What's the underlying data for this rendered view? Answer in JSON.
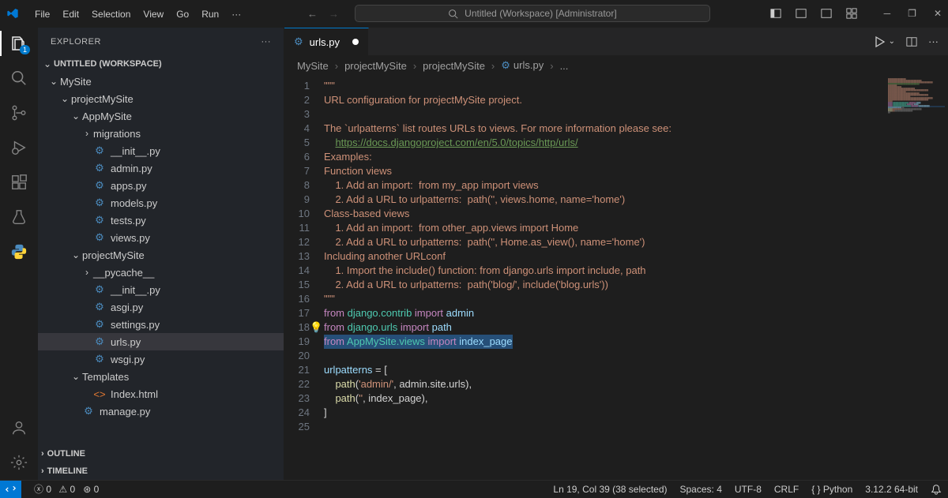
{
  "titlebar": {
    "menus": [
      "File",
      "Edit",
      "Selection",
      "View",
      "Go",
      "Run",
      "···"
    ],
    "command_center": "Untitled (Workspace) [Administrator]"
  },
  "sidebar": {
    "title": "EXPLORER",
    "workspace": "UNTITLED (WORKSPACE)",
    "tree": [
      {
        "label": "MySite",
        "depth": 0,
        "type": "folder",
        "open": true
      },
      {
        "label": "projectMySite",
        "depth": 1,
        "type": "folder",
        "open": true
      },
      {
        "label": "AppMySite",
        "depth": 2,
        "type": "folder",
        "open": true
      },
      {
        "label": "migrations",
        "depth": 3,
        "type": "folder",
        "open": false
      },
      {
        "label": "__init__.py",
        "depth": 3,
        "type": "py"
      },
      {
        "label": "admin.py",
        "depth": 3,
        "type": "py"
      },
      {
        "label": "apps.py",
        "depth": 3,
        "type": "py"
      },
      {
        "label": "models.py",
        "depth": 3,
        "type": "py"
      },
      {
        "label": "tests.py",
        "depth": 3,
        "type": "py"
      },
      {
        "label": "views.py",
        "depth": 3,
        "type": "py"
      },
      {
        "label": "projectMySite",
        "depth": 2,
        "type": "folder",
        "open": true
      },
      {
        "label": "__pycache__",
        "depth": 3,
        "type": "folder",
        "open": false
      },
      {
        "label": "__init__.py",
        "depth": 3,
        "type": "py"
      },
      {
        "label": "asgi.py",
        "depth": 3,
        "type": "py"
      },
      {
        "label": "settings.py",
        "depth": 3,
        "type": "py"
      },
      {
        "label": "urls.py",
        "depth": 3,
        "type": "py",
        "selected": true
      },
      {
        "label": "wsgi.py",
        "depth": 3,
        "type": "py"
      },
      {
        "label": "Templates",
        "depth": 2,
        "type": "folder",
        "open": true
      },
      {
        "label": "Index.html",
        "depth": 3,
        "type": "html"
      },
      {
        "label": "manage.py",
        "depth": 2,
        "type": "py"
      }
    ],
    "outline": "OUTLINE",
    "timeline": "TIMELINE"
  },
  "editor": {
    "tab_label": "urls.py",
    "breadcrumb": [
      "MySite",
      "projectMySite",
      "projectMySite",
      "urls.py",
      "..."
    ],
    "lines": [
      {
        "n": 1,
        "html": "<span class='tok-str'>\"\"\"</span>"
      },
      {
        "n": 2,
        "html": "<span class='tok-str'>URL configuration for projectMySite project.</span>"
      },
      {
        "n": 3,
        "html": ""
      },
      {
        "n": 4,
        "html": "<span class='tok-str'>The `urlpatterns` list routes URLs to views. For more information please see:</span>"
      },
      {
        "n": 5,
        "html": "<span class='tok-str'>    </span><span class='tok-link'>https://docs.djangoproject.com/en/5.0/topics/http/urls/</span>"
      },
      {
        "n": 6,
        "html": "<span class='tok-str'>Examples:</span>"
      },
      {
        "n": 7,
        "html": "<span class='tok-str'>Function views</span>"
      },
      {
        "n": 8,
        "html": "<span class='tok-str'>    1. Add an import:  from my_app import views</span>"
      },
      {
        "n": 9,
        "html": "<span class='tok-str'>    2. Add a URL to urlpatterns:  path('', views.home, name='home')</span>"
      },
      {
        "n": 10,
        "html": "<span class='tok-str'>Class-based views</span>"
      },
      {
        "n": 11,
        "html": "<span class='tok-str'>    1. Add an import:  from other_app.views import Home</span>"
      },
      {
        "n": 12,
        "html": "<span class='tok-str'>    2. Add a URL to urlpatterns:  path('', Home.as_view(), name='home')</span>"
      },
      {
        "n": 13,
        "html": "<span class='tok-str'>Including another URLconf</span>"
      },
      {
        "n": 14,
        "html": "<span class='tok-str'>    1. Import the include() function: from django.urls import include, path</span>"
      },
      {
        "n": 15,
        "html": "<span class='tok-str'>    2. Add a URL to urlpatterns:  path('blog/', include('blog.urls'))</span>"
      },
      {
        "n": 16,
        "html": "<span class='tok-str'>\"\"\"</span>"
      },
      {
        "n": 17,
        "html": "<span class='tok-key'>from</span> <span class='tok-mod'>django.contrib</span> <span class='tok-key'>import</span> <span class='tok-var'>admin</span>"
      },
      {
        "n": 18,
        "html": "<span class='lightbulb'>💡</span><span class='tok-key'>from</span> <span class='tok-mod'>django.urls</span> <span class='tok-key'>import</span> <span class='tok-var'>path</span>"
      },
      {
        "n": 19,
        "html": "<span class='hl-line'><span class='tok-key'>from</span> <span class='tok-mod'>AppMySite.views</span> <span class='tok-key'>import</span> <span class='tok-var'>index_page</span></span>"
      },
      {
        "n": 20,
        "html": ""
      },
      {
        "n": 21,
        "html": "<span class='tok-var'>urlpatterns</span> = ["
      },
      {
        "n": 22,
        "html": "    <span class='tok-func'>path</span>(<span class='tok-str'>'admin/'</span>, admin.site.urls),"
      },
      {
        "n": 23,
        "html": "    <span class='tok-func'>path</span>(<span class='tok-str'>''</span>, index_page),"
      },
      {
        "n": 24,
        "html": "]"
      },
      {
        "n": 25,
        "html": ""
      }
    ]
  },
  "status": {
    "errors": "0",
    "warnings": "0",
    "ports": "0",
    "cursor": "Ln 19, Col 39 (38 selected)",
    "spaces": "Spaces: 4",
    "encoding": "UTF-8",
    "eol": "CRLF",
    "lang": "Python",
    "interp": "3.12.2 64-bit"
  }
}
